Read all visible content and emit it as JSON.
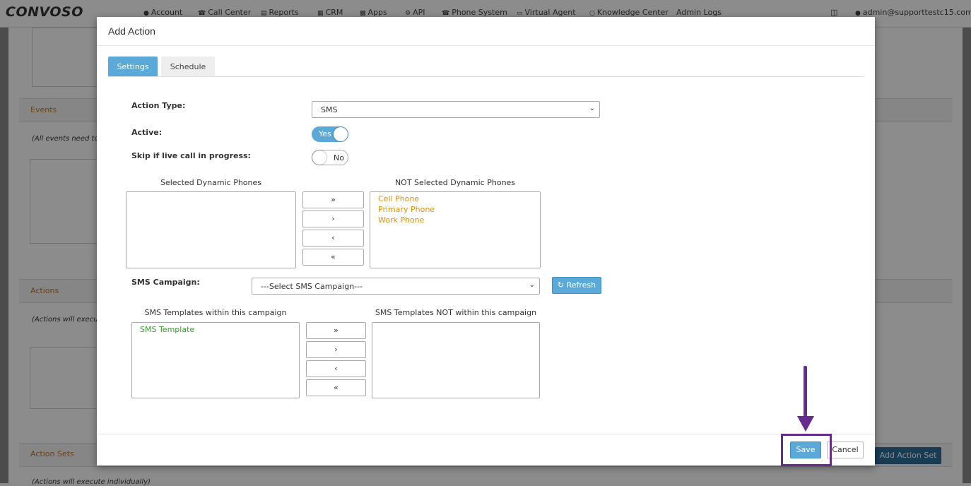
{
  "navbar": {
    "brand": "CONVOSO",
    "items": [
      "Account",
      "Call Center",
      "Reports",
      "CRM",
      "Apps",
      "API",
      "Phone System",
      "Virtual Agent",
      "Knowledge Center",
      "Admin Logs"
    ],
    "user_email": "admin@supporttestc15.com"
  },
  "background": {
    "events_title": "Events",
    "events_note": "(All events need to b",
    "actions_title": "Actions",
    "actions_note": "(Actions will execute",
    "action_sets_title": "Action Sets",
    "action_sets_note": "(Actions will execute individually)",
    "add_action_set_label": "Add Action Set"
  },
  "modal": {
    "title": "Add Action",
    "tabs": [
      {
        "label": "Settings",
        "active": true
      },
      {
        "label": "Schedule",
        "active": false
      }
    ],
    "action_type": {
      "label": "Action Type:",
      "value": "SMS"
    },
    "active": {
      "label": "Active:",
      "state": "Yes"
    },
    "skip_live_call": {
      "label": "Skip if live call in progress:",
      "state": "No"
    },
    "dynamic_phones": {
      "selected_title": "Selected Dynamic Phones",
      "not_selected_title": "NOT Selected Dynamic Phones",
      "selected_items": [],
      "not_selected_items": [
        "Cell Phone",
        "Primary Phone",
        "Work Phone"
      ]
    },
    "sms_campaign": {
      "label": "SMS Campaign:",
      "value": "---Select SMS Campaign---",
      "refresh_label": "Refresh"
    },
    "sms_templates": {
      "within_title": "SMS Templates within this campaign",
      "not_within_title": "SMS Templates NOT within this campaign",
      "within_items": [
        "SMS Template"
      ],
      "not_within_items": []
    },
    "move_buttons": {
      "all_right": "»",
      "one_right": "›",
      "one_left": "‹",
      "all_left": "«"
    },
    "footer": {
      "save_label": "Save",
      "cancel_label": "Cancel"
    }
  },
  "colors": {
    "accent": "#5aa9d8",
    "orange_item": "#e0900f",
    "green_item": "#3a9c2e",
    "annotation": "#6a2b8e"
  }
}
